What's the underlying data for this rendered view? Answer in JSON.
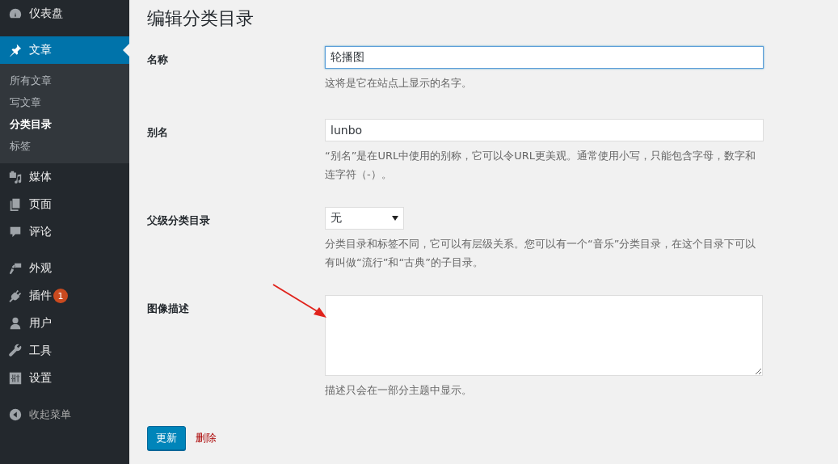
{
  "sidebar": {
    "groups": [
      [
        {
          "label": "仪表盘",
          "selected": false
        }
      ],
      [
        {
          "label": "文章",
          "selected": true,
          "children": [
            {
              "label": "所有文章",
              "selected": false
            },
            {
              "label": "写文章",
              "selected": false
            },
            {
              "label": "分类目录",
              "selected": true
            },
            {
              "label": "标签",
              "selected": false
            }
          ]
        },
        {
          "label": "媒体",
          "selected": false
        },
        {
          "label": "页面",
          "selected": false
        },
        {
          "label": "评论",
          "selected": false
        }
      ],
      [
        {
          "label": "外观",
          "selected": false
        },
        {
          "label": "插件",
          "selected": false,
          "badge": "1"
        },
        {
          "label": "用户",
          "selected": false
        },
        {
          "label": "工具",
          "selected": false
        },
        {
          "label": "设置",
          "selected": false
        }
      ]
    ],
    "collapse": "收起菜单"
  },
  "page_title": "编辑分类目录",
  "fields": [
    {
      "kind": "text",
      "label": "名称",
      "value": "轮播图",
      "focused": true,
      "description": "这将是它在站点上显示的名字。"
    },
    {
      "kind": "text",
      "label": "别名",
      "value": "lunbo",
      "focused": false,
      "description": "“别名”是在URL中使用的别称，它可以令URL更美观。通常使用小写，只能包含字母，数字和连字符（-）。"
    },
    {
      "kind": "select",
      "label": "父级分类目录",
      "value": "无",
      "focused": false,
      "description": "分类目录和标签不同，它可以有层级关系。您可以有一个“音乐”分类目录，在这个目录下可以有叫做“流行”和“古典”的子目录。"
    },
    {
      "kind": "textarea",
      "label": "图像描述",
      "focused": false,
      "description": "描述只会在一部分主题中显示。"
    }
  ],
  "actions": {
    "submit": "更新",
    "delete": "删除"
  }
}
